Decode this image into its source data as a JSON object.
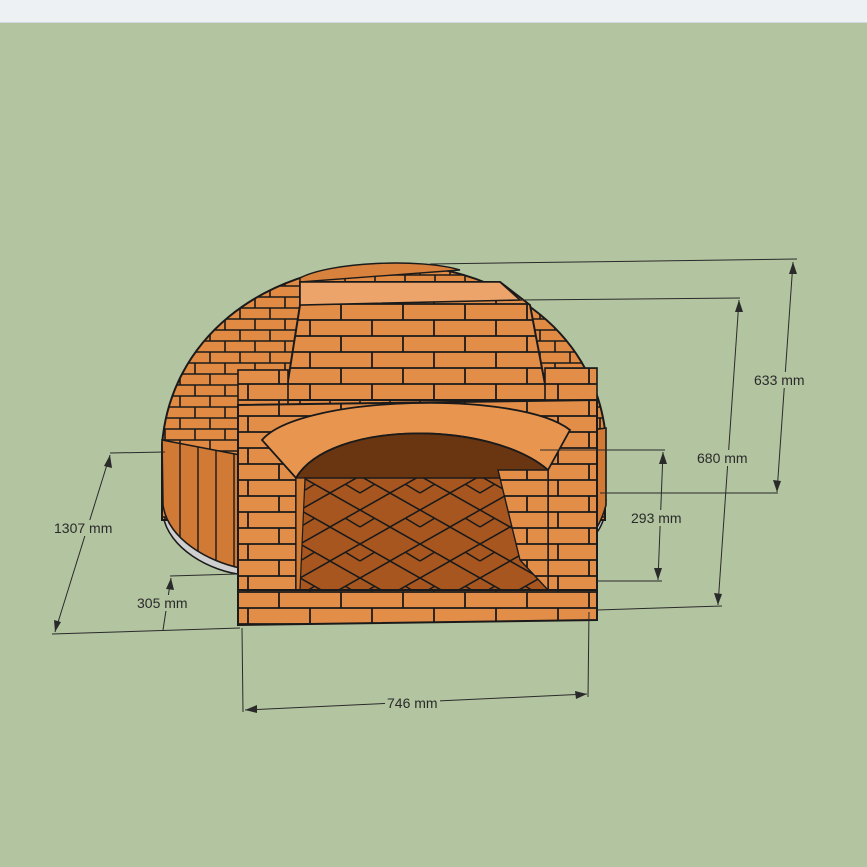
{
  "colors": {
    "background": "#b3c4a0",
    "brick": "#e08a43",
    "brick_light": "#eda46a",
    "brick_dark": "#c06a28",
    "floor": "#a8561f",
    "mortar": "#1a1a1a",
    "base": "#cfcfcf"
  },
  "dimensions": {
    "chimney_height": "633 mm",
    "total_height": "680 mm",
    "opening_height": "293 mm",
    "depth": "1307 mm",
    "base_height": "305 mm",
    "front_width": "746 mm"
  }
}
